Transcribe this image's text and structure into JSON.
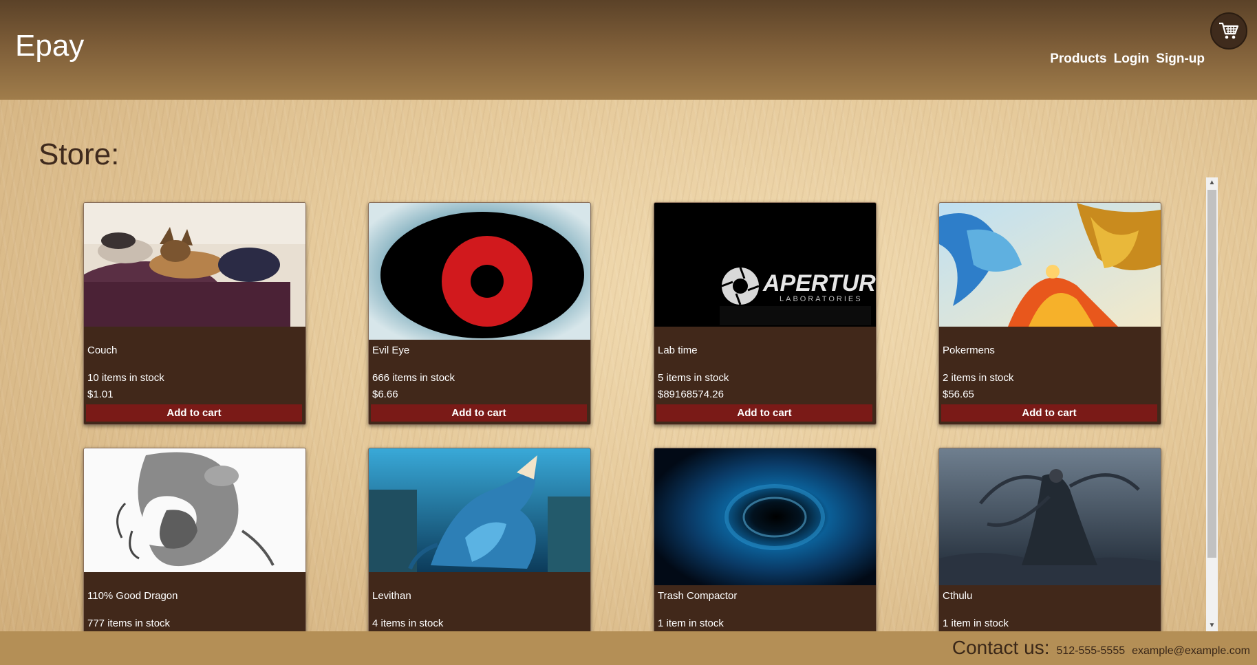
{
  "header": {
    "brand": "Epay",
    "nav": [
      "Products",
      "Login",
      "Sign-up"
    ]
  },
  "store": {
    "title": "Store:",
    "button_label": "Add to cart",
    "products": [
      {
        "name": "Couch",
        "stock": "10 items in stock",
        "price": "$1.01",
        "image": "dogs-on-couch"
      },
      {
        "name": "Evil Eye",
        "stock": "666 items in stock",
        "price": "$6.66",
        "image": "red-eye"
      },
      {
        "name": "Lab time",
        "stock": "5 items in stock",
        "price": "$89168574.26",
        "image": "aperture-logo"
      },
      {
        "name": "Pokermens",
        "stock": "2 items in stock",
        "price": "$56.65",
        "image": "fiery-birds"
      },
      {
        "name": "110% Good Dragon",
        "stock": "777 items in stock",
        "image": "gray-dragon"
      },
      {
        "name": "Levithan",
        "stock": "4 items in stock",
        "image": "sea-monster"
      },
      {
        "name": "Trash Compactor",
        "stock": "1 item in stock",
        "image": "blue-black-hole"
      },
      {
        "name": "Cthulu",
        "stock": "1 item in stock",
        "image": "cthulhu"
      }
    ],
    "aperture_text": "APERTURE",
    "aperture_sub": "LABORATORIES"
  },
  "footer": {
    "label": "Contact us:",
    "phone": "512-555-5555",
    "email": "example@example.com"
  },
  "colors": {
    "card_bg": "#41281a",
    "button_bg": "#7a1a17",
    "header_top": "#5b4228",
    "footer_bg": "#b48f56"
  }
}
